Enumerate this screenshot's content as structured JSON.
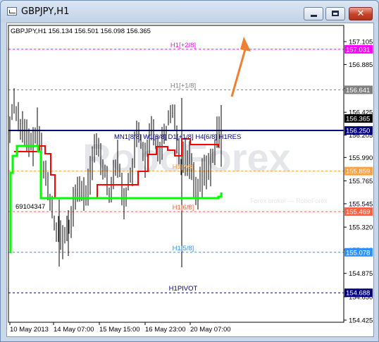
{
  "window": {
    "title": "GBPJPY,H1",
    "minimize_label": "",
    "maximize_label": "",
    "close_label": "✕"
  },
  "chart": {
    "header": "GBPJPY,H1  156.134 156.501 156.098 156.365",
    "watermark": "RoboForex",
    "watermark_sub": "Forex broker — RoboForex",
    "annotation_left": "69104347",
    "resistance_label": "MN1[8/8] W1[8/8] D1[+1/8] H4[6/8] H1RES",
    "colors": {
      "background": "#ffffff",
      "candles": "#000000",
      "grid": "#c0c0c0",
      "resistance": "#000080",
      "green_line": "#00ff00",
      "red_line": "#ff0000",
      "arrow": "#f08030"
    }
  },
  "chart_data": {
    "type": "candlestick",
    "symbol": "GBPJPY",
    "timeframe": "H1",
    "ohlc": {
      "open": 156.134,
      "high": 156.501,
      "low": 156.098,
      "close": 156.365
    },
    "y_ticks": [
      "157.105",
      "156.885",
      "156.655",
      "156.425",
      "156.205",
      "155.990",
      "155.765",
      "155.545",
      "155.320",
      "155.100",
      "154.875",
      "154.650",
      "154.425"
    ],
    "x_ticks": [
      "10 May 2013",
      "14 May 07:00",
      "15 May 15:00",
      "16 May 23:00",
      "20 May 07:00"
    ],
    "levels": [
      {
        "label": "H1[+2/8]",
        "price": 157.031,
        "price_text": "157.031",
        "color": "#ff00ff",
        "style": "dashed"
      },
      {
        "label": "H1[+1/8]",
        "price": 156.641,
        "price_text": "156.641",
        "color": "#808080",
        "style": "dashed"
      },
      {
        "label": "",
        "price": 156.365,
        "price_text": "156.365",
        "color": "#000000",
        "style": "none"
      },
      {
        "label": "",
        "price": 156.25,
        "price_text": "156.250",
        "color": "#000080",
        "style": "solid"
      },
      {
        "label": "H1[7/8]",
        "price": 155.859,
        "price_text": "155.859",
        "color": "#ffa040",
        "style": "dashed"
      },
      {
        "label": "H1[6/8]",
        "price": 155.469,
        "price_text": "155.469",
        "color": "#ff6040",
        "style": "dashed"
      },
      {
        "label": "H1[5/8]",
        "price": 155.078,
        "price_text": "155.078",
        "color": "#3090ff",
        "style": "dashed"
      },
      {
        "label": "H1PIVOT",
        "price": 154.688,
        "price_text": "154.688",
        "color": "#000080",
        "style": "dashed"
      }
    ],
    "ylim": [
      154.36,
      157.3
    ]
  }
}
